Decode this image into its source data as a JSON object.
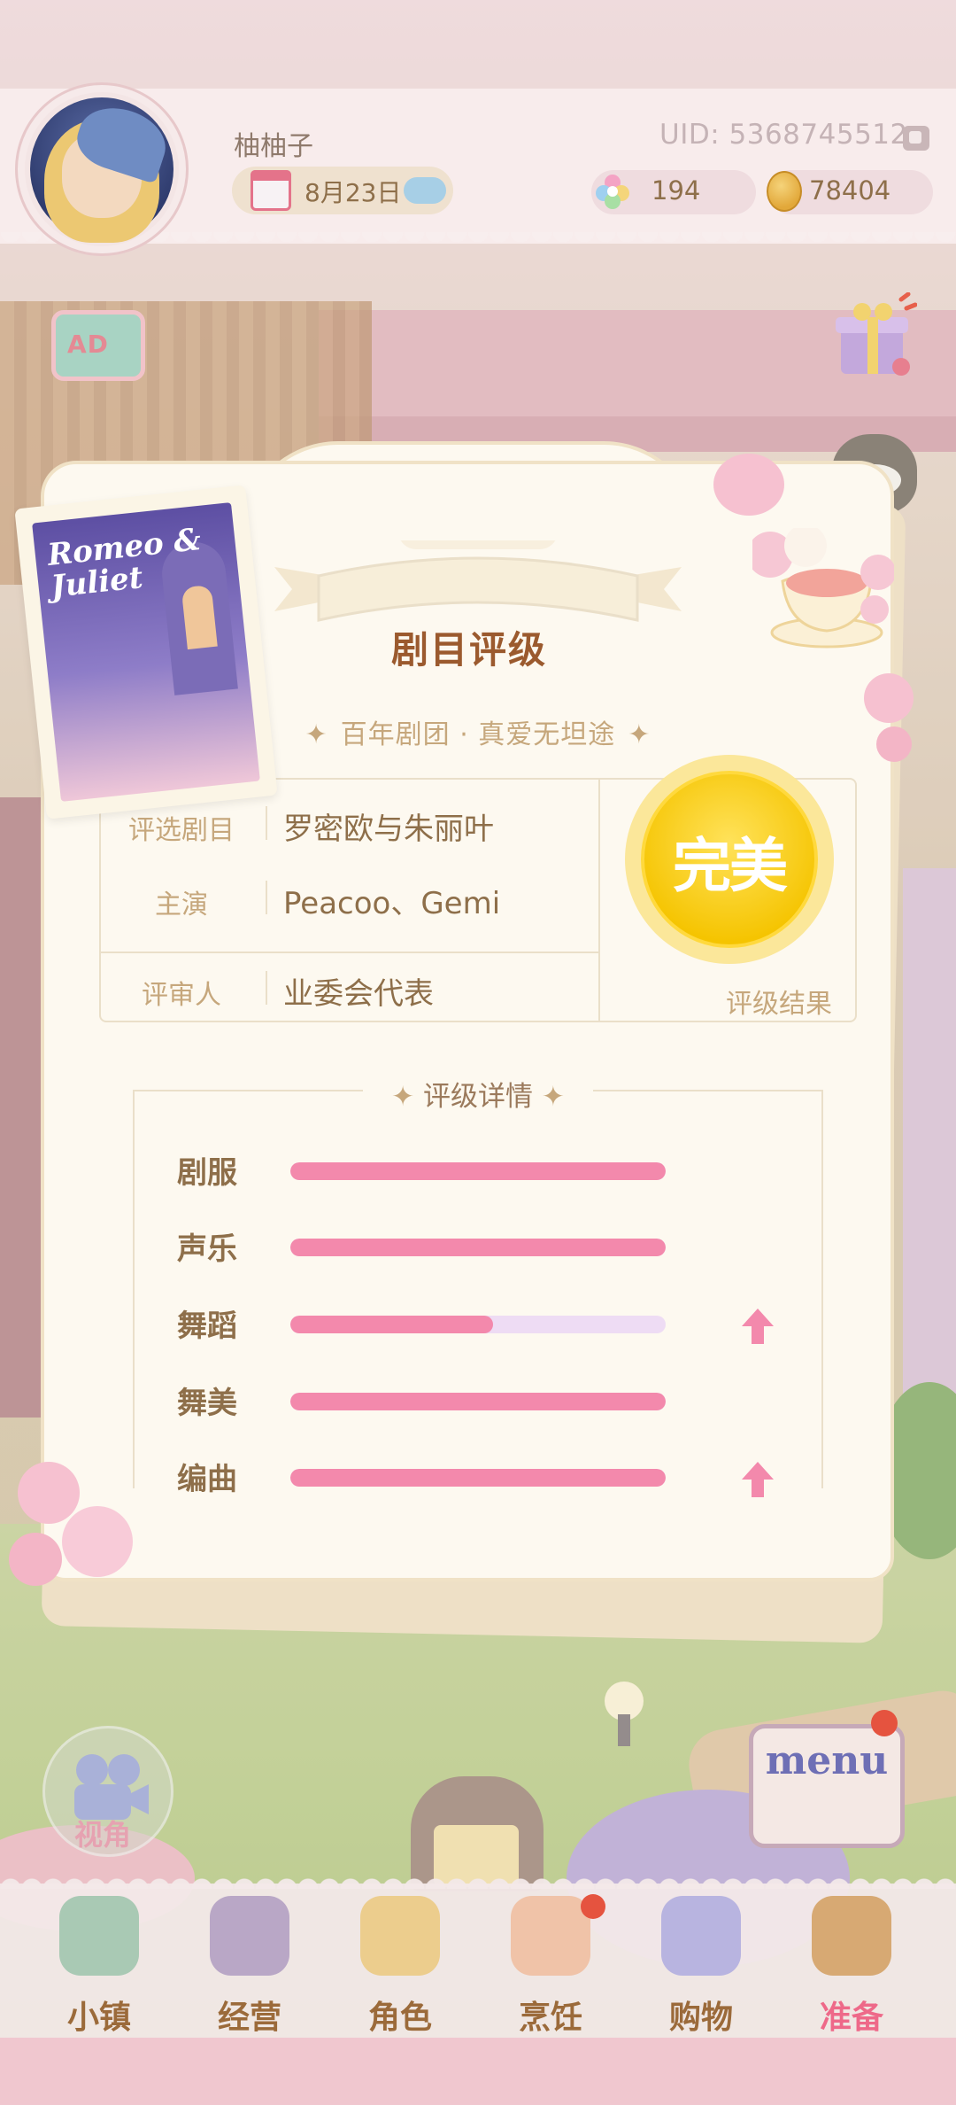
{
  "topbar": {
    "username": "柚柚子",
    "uid": "UID: 5368745512",
    "date": "8月23日",
    "gems": "194",
    "coins": "78404"
  },
  "side": {
    "ad_label": "AD"
  },
  "card": {
    "poster_title": "Romeo & Juliet",
    "title": "剧目评级",
    "subtitle": "百年剧团 · 真爱无坦途",
    "rows": [
      {
        "label": "评选剧目",
        "value": "罗密欧与朱丽叶"
      },
      {
        "label": "主演",
        "value": "Peacoo、Gemi"
      },
      {
        "label": "评审人",
        "value": "业委会代表"
      }
    ],
    "result": {
      "grade": "完美",
      "caption": "评级结果"
    },
    "details": {
      "title": "评级详情",
      "stats": [
        {
          "label": "剧服",
          "fill": 1.0,
          "up": false
        },
        {
          "label": "声乐",
          "fill": 1.0,
          "up": false
        },
        {
          "label": "舞蹈",
          "fill": 0.54,
          "up": true
        },
        {
          "label": "舞美",
          "fill": 1.0,
          "up": false
        },
        {
          "label": "编曲",
          "fill": 1.0,
          "up": true
        }
      ]
    }
  },
  "controls": {
    "view_label": "视角",
    "menu_label": "menu"
  },
  "nav": [
    {
      "label": "小镇",
      "icon": "map-icon",
      "color": "#a9c9b4"
    },
    {
      "label": "经营",
      "icon": "briefcase-icon",
      "color": "#b9a7c6"
    },
    {
      "label": "角色",
      "icon": "character-icon",
      "color": "#eccd8d"
    },
    {
      "label": "烹饪",
      "icon": "food-icon",
      "color": "#f0c3a8"
    },
    {
      "label": "购物",
      "icon": "shopping-bag-icon",
      "color": "#b8b4e0"
    },
    {
      "label": "准备",
      "icon": "basket-icon",
      "color": "#d7a973"
    }
  ],
  "colors": {
    "accent_pink": "#f389ac",
    "track_lavender": "#eedcf4",
    "badge_yellow": "#f5c400",
    "text_brown": "#8e6f4a",
    "label_tan": "#c6a77c"
  }
}
